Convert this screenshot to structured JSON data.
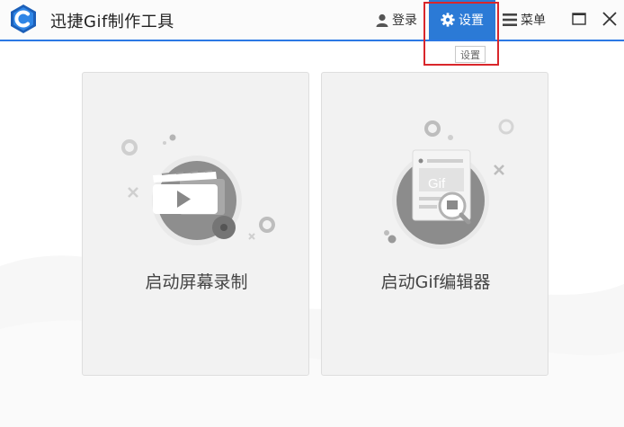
{
  "app": {
    "title": "迅捷Gif制作工具"
  },
  "titlebar": {
    "login_label": "登录",
    "settings_label": "设置",
    "menu_label": "菜单"
  },
  "tooltip": {
    "text": "设置"
  },
  "cards": {
    "screen_record": {
      "label": "启动屏幕录制"
    },
    "gif_editor": {
      "label": "启动Gif编辑器",
      "illustration_text": "Gif"
    }
  },
  "colors": {
    "accent": "#2b7ad6",
    "highlight": "#d9262b"
  },
  "icons": {
    "logo": "app-logo-icon",
    "login": "user-icon",
    "settings": "gear-icon",
    "menu": "hamburger-icon",
    "restore": "maximize-icon",
    "close": "close-icon"
  }
}
